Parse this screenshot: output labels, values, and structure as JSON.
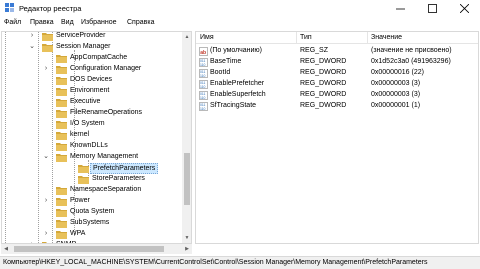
{
  "window": {
    "title": "Редактор реестра",
    "icon": "regedit-icon"
  },
  "menu": [
    "Файл",
    "Правка",
    "Вид",
    "Избранное",
    "Справка"
  ],
  "tree": [
    {
      "label": "ServiceProvider",
      "expander": "›",
      "selected": false
    },
    {
      "label": "Session Manager",
      "expander": "⌄",
      "selected": false
    },
    {
      "label": "AppCompatCache",
      "expander": "",
      "selected": false
    },
    {
      "label": "Configuration Manager",
      "expander": "›",
      "selected": false
    },
    {
      "label": "DOS Devices",
      "expander": "",
      "selected": false
    },
    {
      "label": "Environment",
      "expander": "",
      "selected": false
    },
    {
      "label": "Executive",
      "expander": "",
      "selected": false
    },
    {
      "label": "FileRenameOperations",
      "expander": "",
      "selected": false
    },
    {
      "label": "I/O System",
      "expander": "",
      "selected": false
    },
    {
      "label": "kernel",
      "expander": "",
      "selected": false
    },
    {
      "label": "KnownDLLs",
      "expander": "",
      "selected": false
    },
    {
      "label": "Memory Management",
      "expander": "⌄",
      "selected": false
    },
    {
      "label": "PrefetchParameters",
      "expander": "",
      "selected": true
    },
    {
      "label": "StoreParameters",
      "expander": "",
      "selected": false
    },
    {
      "label": "NamespaceSeparation",
      "expander": "",
      "selected": false
    },
    {
      "label": "Power",
      "expander": "›",
      "selected": false
    },
    {
      "label": "Quota System",
      "expander": "",
      "selected": false
    },
    {
      "label": "SubSystems",
      "expander": "",
      "selected": false
    },
    {
      "label": "WPA",
      "expander": "›",
      "selected": false
    },
    {
      "label": "SNMP",
      "expander": "›",
      "selected": false
    }
  ],
  "list": {
    "headers": {
      "name": "Имя",
      "type": "Тип",
      "value": "Значение"
    },
    "rows": [
      {
        "name": "(По умолчанию)",
        "type": "REG_SZ",
        "value": "(значение не присвоено)",
        "icon": "string-value-icon"
      },
      {
        "name": "BaseTime",
        "type": "REG_DWORD",
        "value": "0x1d52c3a0 (491963296)",
        "icon": "binary-value-icon"
      },
      {
        "name": "BootId",
        "type": "REG_DWORD",
        "value": "0x00000016 (22)",
        "icon": "binary-value-icon"
      },
      {
        "name": "EnablePrefetcher",
        "type": "REG_DWORD",
        "value": "0x00000003 (3)",
        "icon": "binary-value-icon"
      },
      {
        "name": "EnableSuperfetch",
        "type": "REG_DWORD",
        "value": "0x00000003 (3)",
        "icon": "binary-value-icon"
      },
      {
        "name": "SfTracingState",
        "type": "REG_DWORD",
        "value": "0x00000001 (1)",
        "icon": "binary-value-icon"
      }
    ]
  },
  "status": {
    "path": "Компьютер\\HKEY_LOCAL_MACHINE\\SYSTEM\\CurrentControlSet\\Control\\Session Manager\\Memory Management\\PrefetchParameters"
  },
  "colors": {
    "folder": "#e8c15a",
    "folder_dark": "#d4a83a",
    "selection": "#cce8ff",
    "string_icon": "#c0392b",
    "binary_icon": "#2f6fb5"
  }
}
